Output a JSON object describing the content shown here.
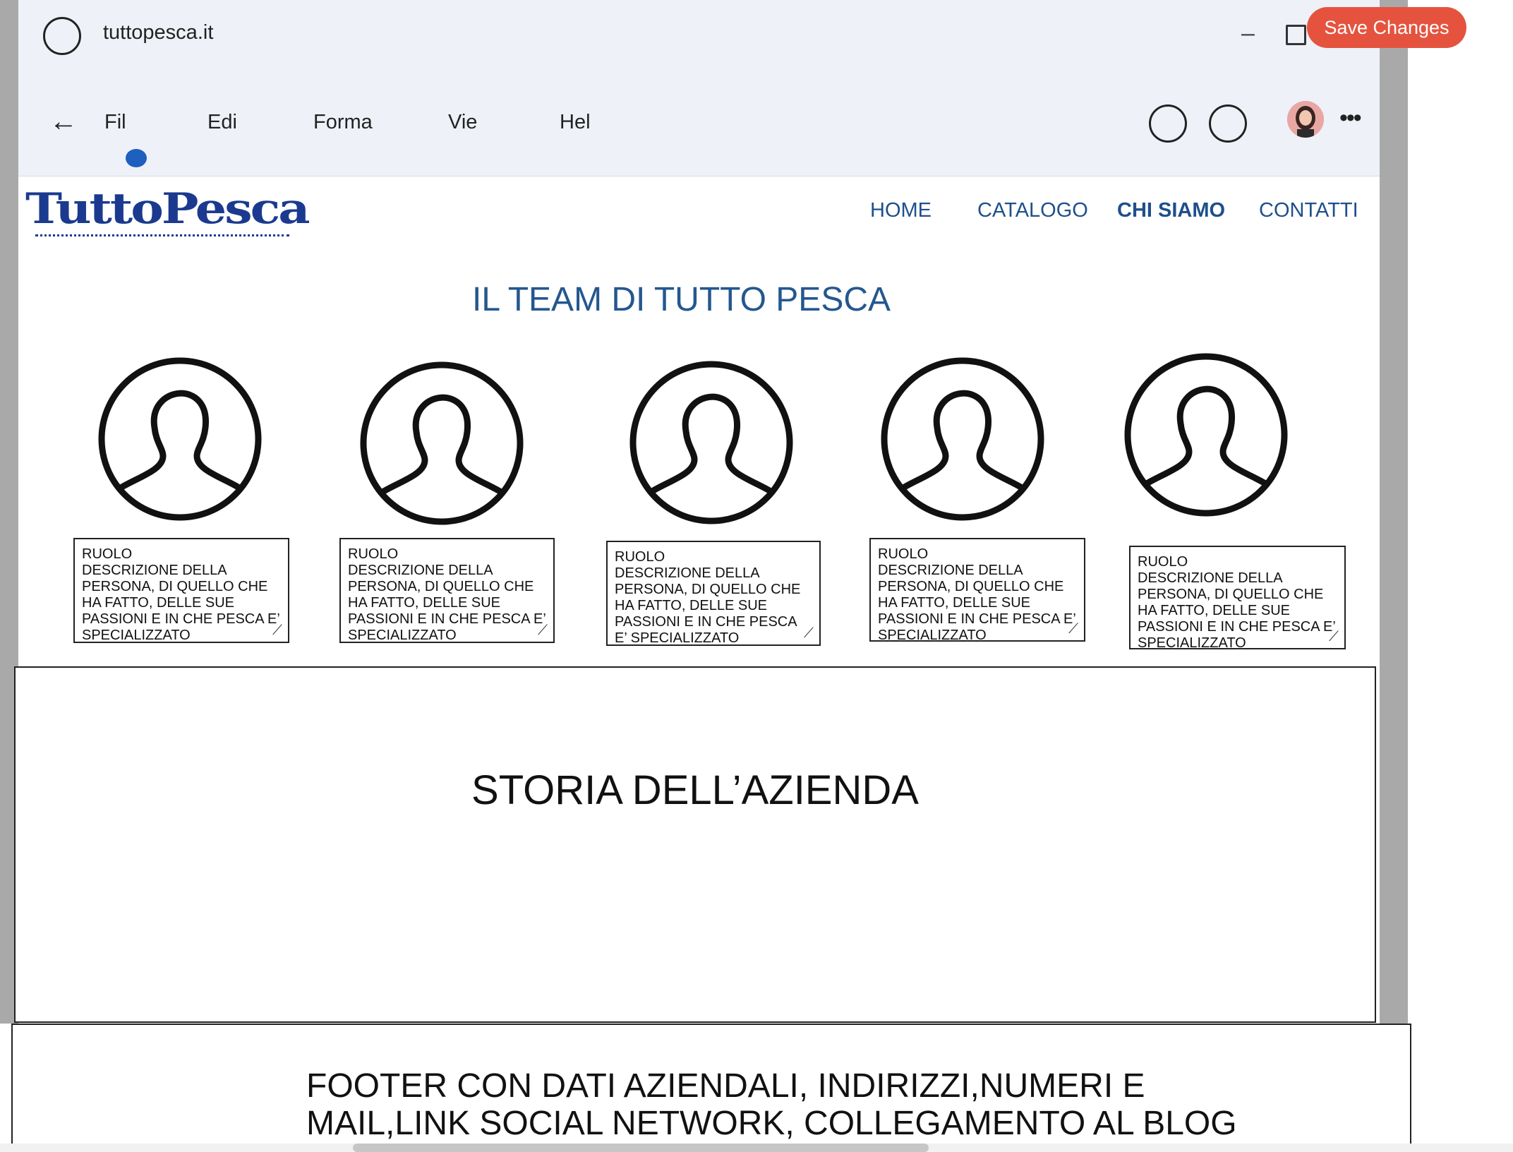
{
  "window": {
    "site": "tuttopesca.it",
    "save_label": "Save Changes",
    "minimize": "–",
    "back_arrow": "←",
    "more": "•••"
  },
  "menu": {
    "items": [
      "Fil",
      "Edi",
      "Forma",
      "Vie",
      "Hel"
    ]
  },
  "site": {
    "logo_text": "TuttoPesca",
    "nav": [
      "HOME",
      "CATALOGO",
      "CHI SIAMO",
      "CONTATTI"
    ],
    "active_nav": "CHI SIAMO",
    "team_title": "IL TEAM DI TUTTO PESCA",
    "team": [
      {
        "role": "RUOLO",
        "desc": "DESCRIZIONE DELLA PERSONA, DI QUELLO CHE HA FATTO, DELLE SUE PASSIONI E IN CHE PESCA E’ SPECIALIZZATO"
      },
      {
        "role": "RUOLO",
        "desc": "DESCRIZIONE DELLA PERSONA, DI QUELLO CHE HA FATTO, DELLE SUE PASSIONI E IN CHE PESCA E’ SPECIALIZZATO"
      },
      {
        "role": "RUOLO",
        "desc": "DESCRIZIONE DELLA PERSONA, DI QUELLO CHE HA FATTO, DELLE SUE PASSIONI E IN CHE PESCA E’ SPECIALIZZATO"
      },
      {
        "role": "RUOLO",
        "desc": "DESCRIZIONE DELLA PERSONA, DI QUELLO CHE HA FATTO, DELLE SUE PASSIONI E IN CHE PESCA E’ SPECIALIZZATO"
      },
      {
        "role": "RUOLO",
        "desc": "DESCRIZIONE DELLA PERSONA, DI QUELLO CHE HA FATTO, DELLE SUE PASSIONI E IN CHE PESCA E’ SPECIALIZZATO"
      }
    ],
    "history_title": "STORIA DELL’AZIENDA",
    "footer_text": "FOOTER CON DATI AZIENDALI, INDIRIZZI,NUMERI E MAIL,LINK SOCIAL NETWORK, COLLEGAMENTO AL BLOG"
  },
  "colors": {
    "accent": "#e5533f",
    "nav_text": "#1e4f8c",
    "logo": "#1b3a8f",
    "menu_dot": "#1f5fbf"
  },
  "icons": [
    "tab-icon",
    "minimize-icon",
    "maximize-icon",
    "back-arrow-icon",
    "user-placeholder-icon",
    "more-icon",
    "resize-handle-icon"
  ]
}
